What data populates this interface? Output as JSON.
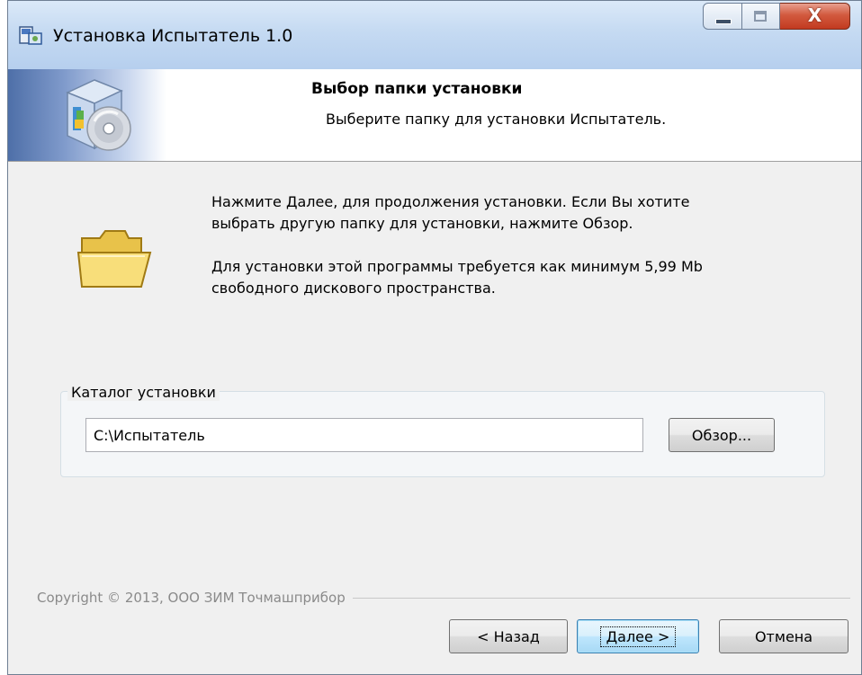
{
  "window": {
    "title": "Установка Испытатель 1.0",
    "close_glyph": "X"
  },
  "header": {
    "title": "Выбор папки установки",
    "subtitle": "Выберите папку для установки Испытатель."
  },
  "body": {
    "paragraph1_line1": "Нажмите Далее, для продолжения установки. Если Вы хотите",
    "paragraph1_line2": "выбрать другую папку для установки, нажмите Обзор.",
    "paragraph2_line1": "Для установки этой программы требуется как минимум 5,99 Mb",
    "paragraph2_line2": "свободного дискового пространства."
  },
  "install_dir": {
    "group_label": "Каталог установки",
    "path_value": "C:\\Испытатель",
    "browse_label": "Обзор..."
  },
  "footer": {
    "copyright": "Copyright © 2013, ООО ЗИМ Точмашприбор",
    "back_label": "< Назад",
    "next_label": "Далее >",
    "cancel_label": "Отмена"
  },
  "icons": {
    "app": "installer-app-icon",
    "header": "software-box-cd-icon",
    "folder": "folder-icon"
  }
}
